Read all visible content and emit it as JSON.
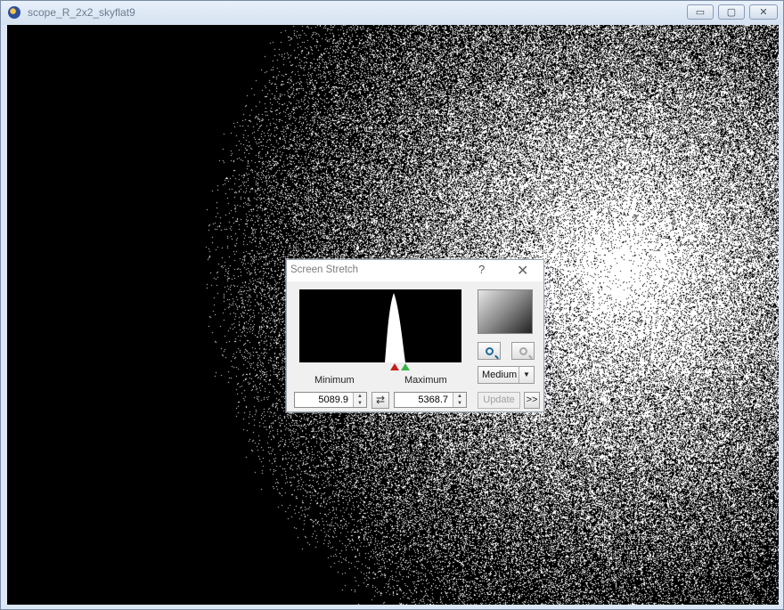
{
  "window": {
    "title": "scope_R_2x2_skyflat9",
    "buttons": {
      "minimize": "▭",
      "maximize": "▢",
      "close": "✕"
    }
  },
  "image": {
    "description_icon": "image-canvas"
  },
  "dialog": {
    "title": "Screen Stretch",
    "help": "?",
    "close": "✕",
    "minimum_label": "Minimum",
    "maximum_label": "Maximum",
    "minimum_value": "5089.9",
    "maximum_value": "5368.7",
    "swap_icon": "⇄",
    "zoom_level": "Medium",
    "update_label": "Update",
    "more_label": ">>",
    "colors": {
      "min_marker": "#c42020",
      "max_marker": "#3bb34a"
    }
  }
}
